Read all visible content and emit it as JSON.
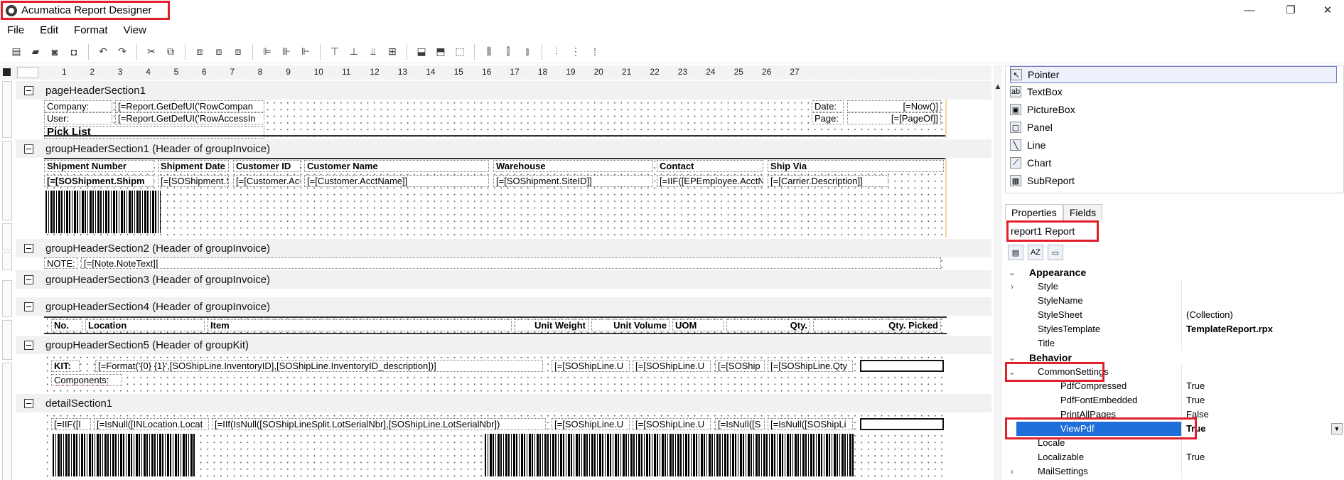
{
  "window": {
    "title": "Acumatica Report Designer",
    "minimize": "—",
    "maximize": "❐",
    "close": "✕"
  },
  "menu": [
    "File",
    "Edit",
    "Format",
    "View"
  ],
  "ruler": {
    "numbers": [
      "1",
      "2",
      "3",
      "4",
      "5",
      "6",
      "7",
      "8",
      "9",
      "10",
      "11",
      "12",
      "13",
      "14",
      "15",
      "16",
      "17",
      "18",
      "19",
      "20",
      "21",
      "22",
      "23",
      "24",
      "25",
      "26",
      "27"
    ]
  },
  "sections": {
    "pageHeader": {
      "title": "pageHeaderSection1",
      "company_label": "Company:",
      "company_value": "[=Report.GetDefUI('RowCompan",
      "user_label": "User:",
      "user_value": "[=Report.GetDefUI('RowAccessIn",
      "pick_list": "Pick List",
      "date_label": "Date:",
      "date_value": "[=Now()]",
      "page_label": "Page:",
      "page_value": "[=[PageOf]]"
    },
    "group1": {
      "title": "groupHeaderSection1 (Header of groupInvoice)",
      "headers": [
        "Shipment Number",
        "Shipment Date",
        "Customer ID",
        "Customer Name",
        "Warehouse",
        "Contact",
        "Ship Via"
      ],
      "values": [
        "[=[SOShipment.Shipm",
        "[=[SOShipment.Sh",
        "[=[Customer.Acct",
        "[=[Customer.AcctName]]",
        "[=[SOShipment.SiteID]]",
        "[=IIF([EPEmployee.AcctNam",
        "[=[Carrier.Description]]"
      ]
    },
    "group2": {
      "title": "groupHeaderSection2 (Header of groupInvoice)",
      "note_label": "NOTE:",
      "note_value": "[=[Note.NoteText]]"
    },
    "group3": {
      "title": "groupHeaderSection3 (Header of groupInvoice)"
    },
    "group4": {
      "title": "groupHeaderSection4 (Header of groupInvoice)",
      "headers": [
        "No.",
        "Location",
        "Item",
        "Unit Weight",
        "Unit Volume",
        "UOM",
        "Qty.",
        "Qty. Picked"
      ]
    },
    "group5": {
      "title": "groupHeaderSection5 (Header of groupKit)",
      "kit_label": "KIT:",
      "kit_format": "[=Format('{0} {1}',[SOShipLine.InventoryID],[SOShipLine.InventoryID_description])]",
      "col1": "[=[SOShipLine.U",
      "col2": "[=[SOShipLine.U",
      "col3": "[=[SOShip",
      "col4": "[=[SOShipLine.Qty",
      "components": "Components:"
    },
    "detail": {
      "title": "detailSection1",
      "cells": [
        "[=IIF([I",
        "[=IsNull([INLocation.Locat",
        "[=IIf(IsNull([SOShipLineSplit.LotSerialNbr],[SOShipLine.LotSerialNbr])",
        "[=[SOShipLine.U",
        "[=[SOShipLine.U",
        "[=IsNull([S",
        "[=IsNull([SOShipLi"
      ]
    }
  },
  "toolbox": {
    "items": [
      {
        "label": "Pointer",
        "icon": "pointer-icon"
      },
      {
        "label": "TextBox",
        "icon": "textbox-icon"
      },
      {
        "label": "PictureBox",
        "icon": "picturebox-icon"
      },
      {
        "label": "Panel",
        "icon": "panel-icon"
      },
      {
        "label": "Line",
        "icon": "line-icon"
      },
      {
        "label": "Chart",
        "icon": "chart-icon"
      },
      {
        "label": "SubReport",
        "icon": "subreport-icon"
      }
    ]
  },
  "properties": {
    "tabs": [
      "Properties",
      "Fields"
    ],
    "object": "report1 Report",
    "rows": [
      {
        "name": "Appearance",
        "value": "",
        "kind": "cat",
        "gutter": "⌄"
      },
      {
        "name": "Style",
        "value": "",
        "kind": "child",
        "gutter": "›"
      },
      {
        "name": "StyleName",
        "value": "",
        "kind": "child",
        "gutter": ""
      },
      {
        "name": "StyleSheet",
        "value": "(Collection)",
        "kind": "child",
        "gutter": ""
      },
      {
        "name": "StylesTemplate",
        "value": "TemplateReport.rpx",
        "kind": "child",
        "gutter": "",
        "bold": true
      },
      {
        "name": "Title",
        "value": "",
        "kind": "child",
        "gutter": ""
      },
      {
        "name": "Behavior",
        "value": "",
        "kind": "cat",
        "gutter": "⌄"
      },
      {
        "name": "CommonSettings",
        "value": "",
        "kind": "child",
        "gutter": "⌄"
      },
      {
        "name": "PdfCompressed",
        "value": "True",
        "kind": "gchild",
        "gutter": ""
      },
      {
        "name": "PdfFontEmbedded",
        "value": "True",
        "kind": "gchild",
        "gutter": ""
      },
      {
        "name": "PrintAllPages",
        "value": "False",
        "kind": "gchild",
        "gutter": ""
      },
      {
        "name": "ViewPdf",
        "value": "True",
        "kind": "gchild",
        "gutter": "",
        "bold": true,
        "selected": true
      },
      {
        "name": "Locale",
        "value": "",
        "kind": "child",
        "gutter": ""
      },
      {
        "name": "Localizable",
        "value": "True",
        "kind": "child",
        "gutter": ""
      },
      {
        "name": "MailSettings",
        "value": "",
        "kind": "child",
        "gutter": "›"
      }
    ]
  },
  "colors": {
    "highlight": "#e0202a",
    "selection": "#1e6fd9"
  }
}
